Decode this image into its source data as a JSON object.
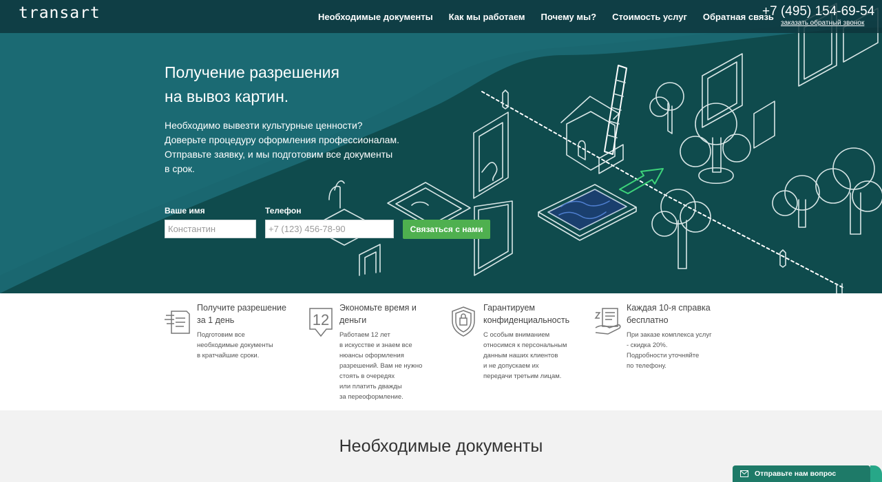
{
  "header": {
    "logo": "transart",
    "nav": [
      "Необходимые документы",
      "Как мы работаем",
      "Почему мы?",
      "Стоимость услуг",
      "Обратная связь"
    ],
    "phone": "+7 (495) 154-69-54",
    "callback": "заказать обратный звонок"
  },
  "hero": {
    "title_lines": [
      "Получение разрешения",
      "на вывоз картин."
    ],
    "desc_lines": [
      "Необходимо вывезти культурные ценности?",
      "Доверьте процедуру оформления профессионалам.",
      "Отправьте заявку, и мы подготовим все документы",
      "в срок."
    ],
    "form": {
      "name_label": "Ваше имя",
      "name_placeholder": "Константин",
      "phone_label": "Телефон",
      "phone_placeholder": "+7 (123) 456-78-90",
      "submit_label": "Связаться с нами"
    }
  },
  "features": [
    {
      "icon": "fast-doc-icon",
      "title": [
        "Получите разрешение",
        "за 1 день"
      ],
      "text": [
        "Подготовим все",
        "необходимые документы",
        "в кратчайшие сроки."
      ]
    },
    {
      "icon": "twelve-years-badge-icon",
      "badge": "12",
      "title": [
        "Экономьте время и",
        "деньги"
      ],
      "text": [
        "Работаем 12 лет",
        "в искусстве и знаем все",
        "нюансы оформления",
        "разрешений. Вам не нужно",
        "стоять в очередях",
        "или платить дважды",
        "за переоформление."
      ]
    },
    {
      "icon": "shield-lock-icon",
      "title": [
        "Гарантируем",
        "конфиденциальность"
      ],
      "text": [
        "С особым вниманием",
        "относимся к персональным",
        "данным наших клиентов",
        "и не допускаем их",
        "передачи третьим лицам."
      ]
    },
    {
      "icon": "free-document-icon",
      "title": [
        "Каждая 10-я справка",
        "бесплатно"
      ],
      "text": [
        "При заказе комплекса услуг",
        "- скидка 20%.",
        "Подробности уточняйте",
        "по телефону."
      ]
    }
  ],
  "docs": {
    "title": "Необходимые документы"
  },
  "ask": {
    "label": "Отправьте нам вопрос",
    "icon": "mail-icon"
  },
  "colors": {
    "hero_dark": "#0f4c4e",
    "hero_light": "#1a6a70",
    "accent_green": "#4fb04f",
    "ask_button": "#1e7a68"
  }
}
